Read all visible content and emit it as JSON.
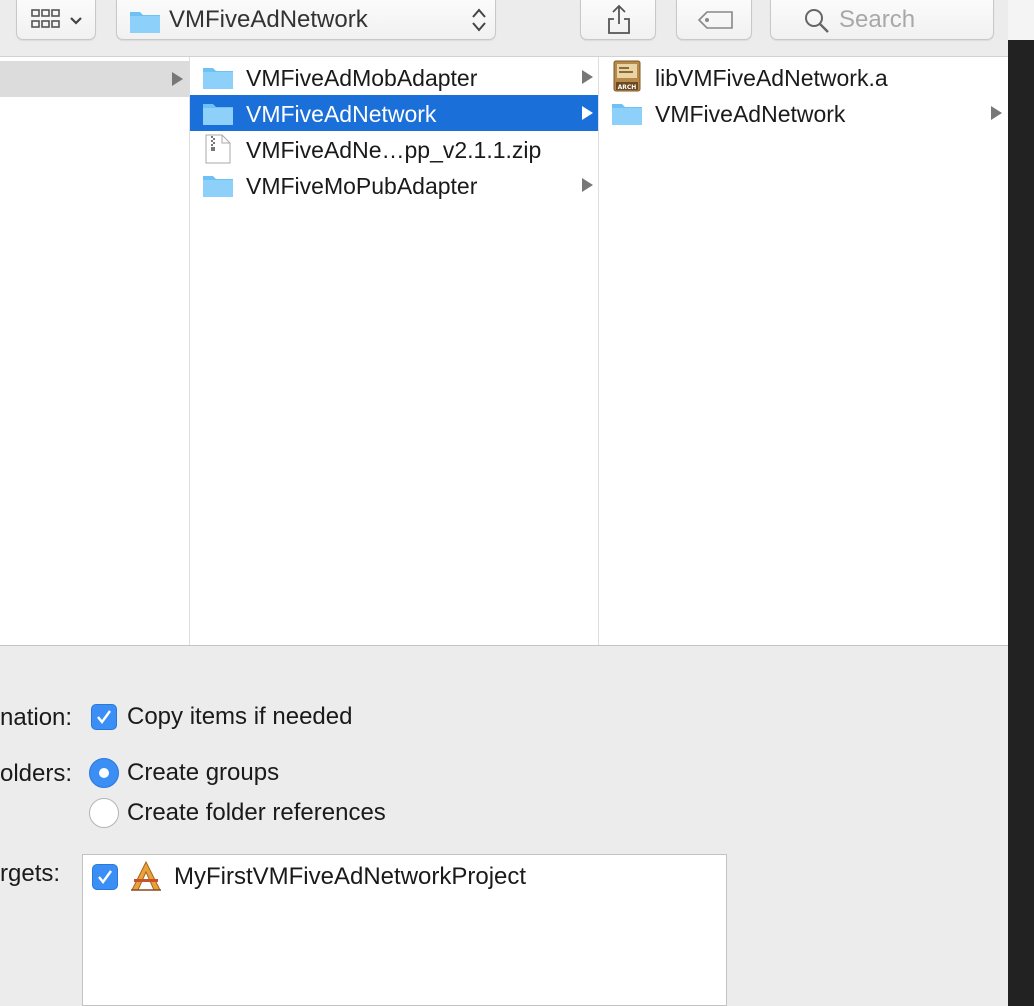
{
  "toolbar": {
    "path_title": "VMFiveAdNetwork",
    "search_placeholder": "Search"
  },
  "column2": {
    "items": [
      {
        "name": "VMFiveAdMobAdapter",
        "kind": "folder",
        "has_children": true
      },
      {
        "name": "VMFiveAdNetwork",
        "kind": "folder",
        "has_children": true,
        "selected": true
      },
      {
        "name": "VMFiveAdNe…pp_v2.1.1.zip",
        "kind": "zip",
        "has_children": false
      },
      {
        "name": "VMFiveMoPubAdapter",
        "kind": "folder",
        "has_children": true
      }
    ]
  },
  "column3": {
    "items": [
      {
        "name": "libVMFiveAdNetwork.a",
        "kind": "archive",
        "icon_text": "ARCH",
        "has_children": false
      },
      {
        "name": "VMFiveAdNetwork",
        "kind": "folder",
        "has_children": true
      }
    ]
  },
  "options": {
    "destination_label": "nation:",
    "copy_items": "Copy items if needed",
    "folders_label": "olders:",
    "create_groups": "Create groups",
    "create_folder_refs": "Create folder references",
    "targets_label": "rgets:",
    "target_name": "MyFirstVMFiveAdNetworkProject"
  },
  "colors": {
    "selection": "#1a6fd8",
    "checkbox": "#3b8ef4",
    "folder": "#6ec0f5"
  }
}
